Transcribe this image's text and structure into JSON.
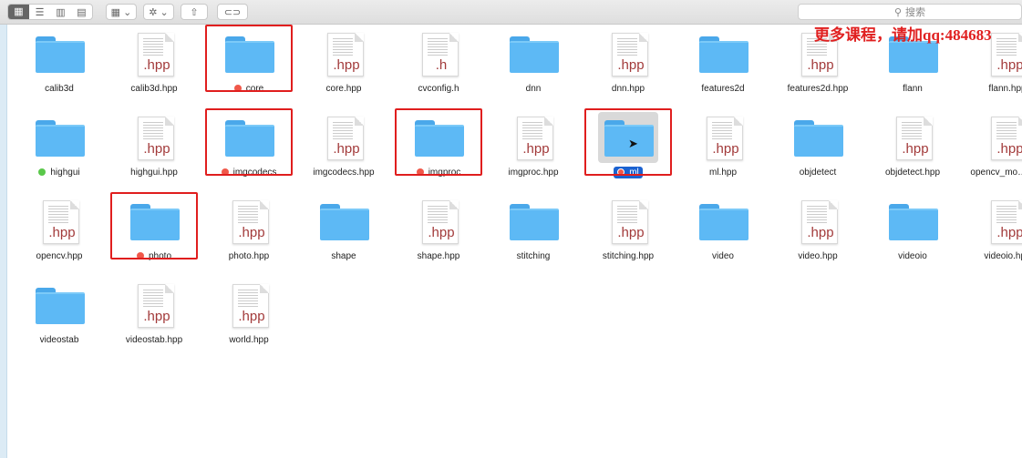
{
  "toolbar": {
    "view_icons": [
      "icon-view-icon",
      "list-view-icon",
      "column-view-icon",
      "gallery-view-icon"
    ],
    "arrange_icon": "arrange-icon",
    "action_icon": "gear-icon",
    "share_icon": "share-icon",
    "tag_icon": "tag-icon",
    "search_placeholder": "搜索"
  },
  "watermark": "更多课程，请加qq:484683",
  "colors": {
    "folder": "#5db9f5",
    "tag_red": "#f0584a",
    "tag_green": "#5ac84a",
    "selection": "#1b62d0",
    "highlight_box": "#e01e1e"
  },
  "files": [
    {
      "name": "calib3d",
      "type": "folder"
    },
    {
      "name": "calib3d.hpp",
      "type": "doc",
      "ext": ".hpp"
    },
    {
      "name": "core",
      "type": "folder",
      "tag": "red",
      "boxed": true
    },
    {
      "name": "core.hpp",
      "type": "doc",
      "ext": ".hpp"
    },
    {
      "name": "cvconfig.h",
      "type": "doc",
      "ext": ".h"
    },
    {
      "name": "dnn",
      "type": "folder"
    },
    {
      "name": "dnn.hpp",
      "type": "doc",
      "ext": ".hpp"
    },
    {
      "name": "features2d",
      "type": "folder"
    },
    {
      "name": "features2d.hpp",
      "type": "doc",
      "ext": ".hpp"
    },
    {
      "name": "flann",
      "type": "folder"
    },
    {
      "name": "flann.hpp",
      "type": "doc",
      "ext": ".hpp"
    },
    {
      "name": "highgui",
      "type": "folder",
      "tag": "green"
    },
    {
      "name": "highgui.hpp",
      "type": "doc",
      "ext": ".hpp"
    },
    {
      "name": "imgcodecs",
      "type": "folder",
      "tag": "red",
      "boxed": true
    },
    {
      "name": "imgcodecs.hpp",
      "type": "doc",
      "ext": ".hpp"
    },
    {
      "name": "imgproc",
      "type": "folder",
      "tag": "red",
      "boxed": true
    },
    {
      "name": "imgproc.hpp",
      "type": "doc",
      "ext": ".hpp"
    },
    {
      "name": "ml",
      "type": "folder",
      "tag": "red",
      "boxed": true,
      "selected": true
    },
    {
      "name": "ml.hpp",
      "type": "doc",
      "ext": ".hpp"
    },
    {
      "name": "objdetect",
      "type": "folder"
    },
    {
      "name": "objdetect.hpp",
      "type": "doc",
      "ext": ".hpp"
    },
    {
      "name": "opencv_mo… hpp",
      "type": "doc",
      "ext": ".hpp"
    },
    {
      "name": "opencv.hpp",
      "type": "doc",
      "ext": ".hpp"
    },
    {
      "name": "photo",
      "type": "folder",
      "tag": "red",
      "boxed": true
    },
    {
      "name": "photo.hpp",
      "type": "doc",
      "ext": ".hpp"
    },
    {
      "name": "shape",
      "type": "folder"
    },
    {
      "name": "shape.hpp",
      "type": "doc",
      "ext": ".hpp"
    },
    {
      "name": "stitching",
      "type": "folder"
    },
    {
      "name": "stitching.hpp",
      "type": "doc",
      "ext": ".hpp"
    },
    {
      "name": "video",
      "type": "folder"
    },
    {
      "name": "video.hpp",
      "type": "doc",
      "ext": ".hpp"
    },
    {
      "name": "videoio",
      "type": "folder"
    },
    {
      "name": "videoio.hpp",
      "type": "doc",
      "ext": ".hpp"
    },
    {
      "name": "videostab",
      "type": "folder"
    },
    {
      "name": "videostab.hpp",
      "type": "doc",
      "ext": ".hpp"
    },
    {
      "name": "world.hpp",
      "type": "doc",
      "ext": ".hpp"
    }
  ]
}
